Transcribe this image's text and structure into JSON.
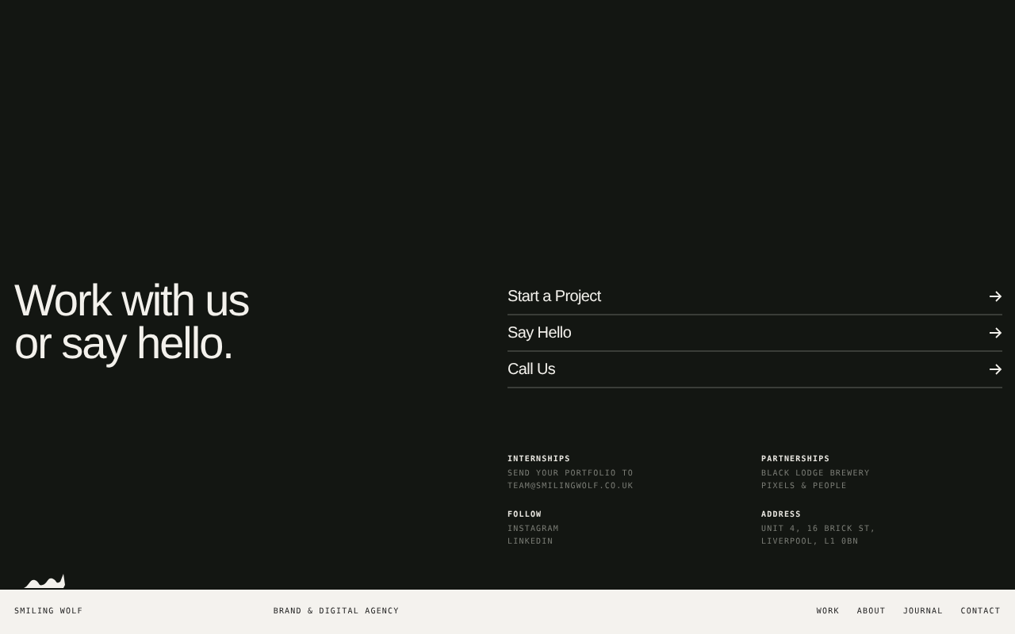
{
  "headline": [
    "Work with us",
    "or say hello."
  ],
  "links": [
    {
      "label": "Start a Project"
    },
    {
      "label": "Say Hello"
    },
    {
      "label": "Call Us"
    }
  ],
  "info": [
    {
      "title": "INTERNSHIPS",
      "lines": [
        "SEND YOUR PORTFOLIO TO",
        "TEAM@SMILINGWOLF.CO.UK"
      ]
    },
    {
      "title": "PARTNERSHIPS",
      "lines": [
        "BLACK LODGE BREWERY",
        "PIXELS & PEOPLE"
      ]
    },
    {
      "title": "FOLLOW",
      "lines": [
        "INSTAGRAM",
        "LINKEDIN"
      ]
    },
    {
      "title": "ADDRESS",
      "lines": [
        "UNIT 4, 16 BRICK ST,",
        "LIVERPOOL, L1 0BN"
      ]
    }
  ],
  "footer": {
    "brand": "SMILING WOLF",
    "tagline": "BRAND & DIGITAL AGENCY",
    "nav": [
      "WORK",
      "ABOUT",
      "JOURNAL",
      "CONTACT"
    ]
  }
}
